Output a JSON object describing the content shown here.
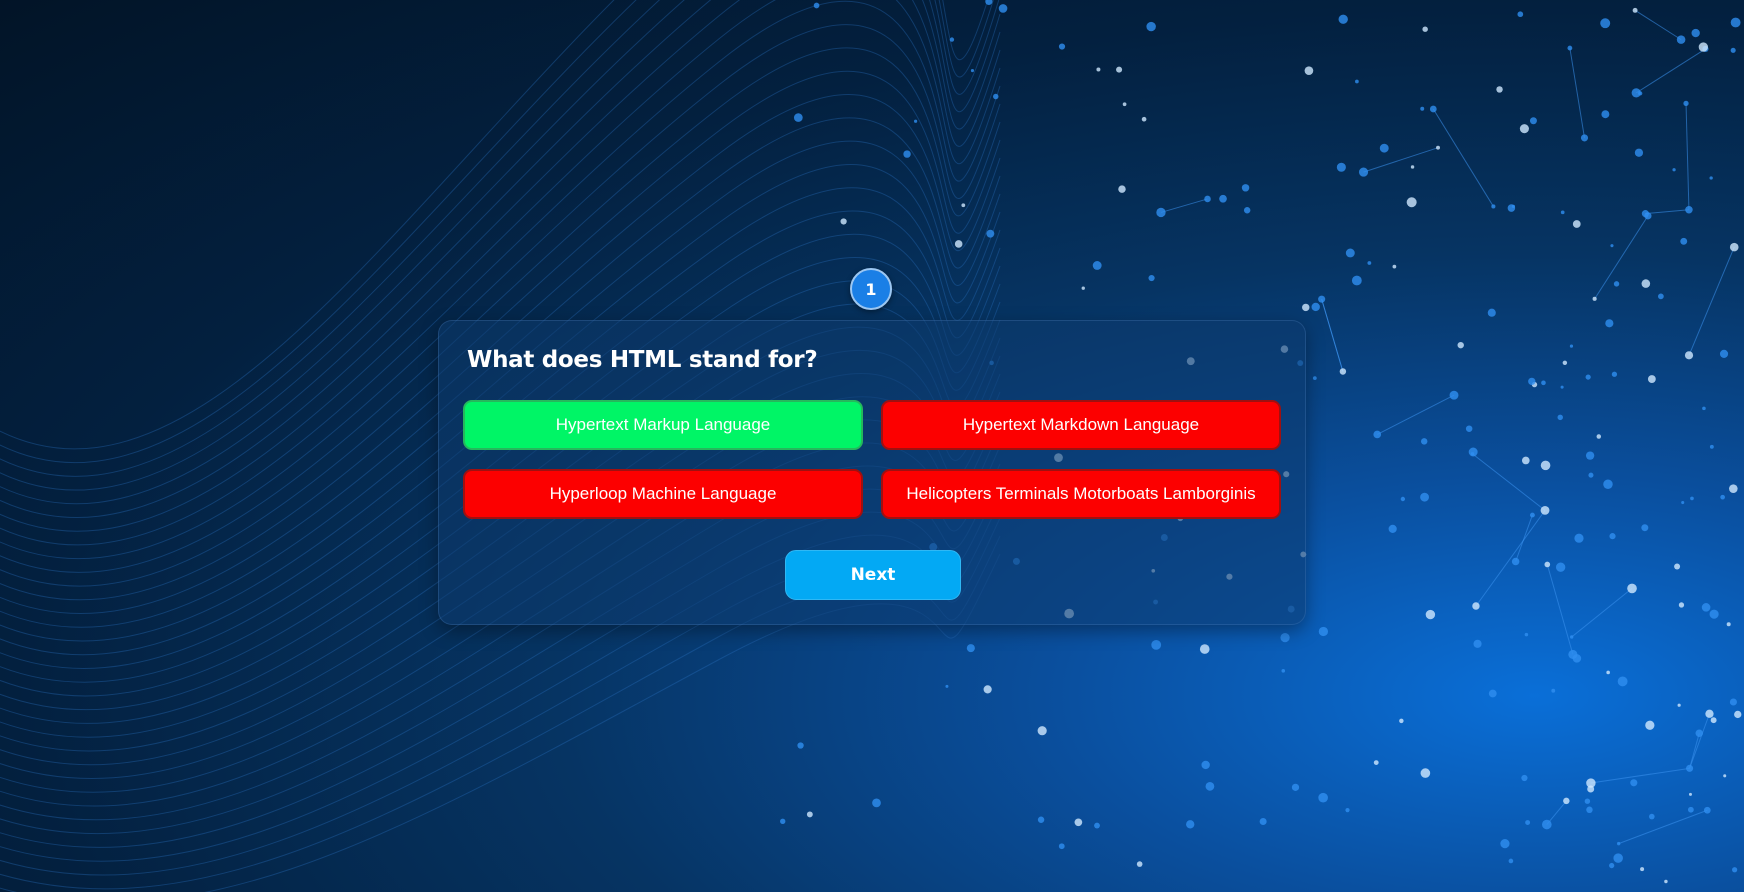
{
  "quiz": {
    "question_number": "1",
    "question": "What does HTML stand for?",
    "answers": [
      {
        "label": "Hypertext Markup Language",
        "status": "correct"
      },
      {
        "label": "Hypertext Markdown Language",
        "status": "wrong"
      },
      {
        "label": "Hyperloop Machine Language",
        "status": "wrong"
      },
      {
        "label": "Helicopters Terminals Motorboats Lamborginis",
        "status": "wrong"
      }
    ],
    "next_label": "Next"
  },
  "colors": {
    "correct": "#00f566",
    "wrong": "#fc0000",
    "next_button": "#03a9f4",
    "counter_badge": "#1a7fe6",
    "background_deep": "#021427",
    "background_glow": "#0a6fd8"
  }
}
